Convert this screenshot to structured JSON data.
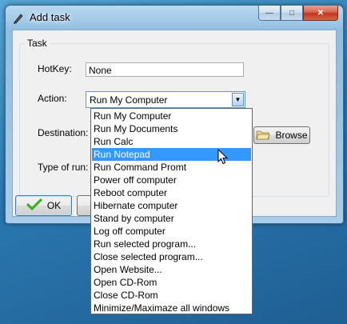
{
  "window": {
    "title": "Add task",
    "minimize_glyph": "—",
    "maximize_glyph": "□",
    "close_glyph": "✕"
  },
  "task_group": {
    "label": "Task",
    "hotkey_label": "HotKey:",
    "hotkey_value": "None",
    "action_label": "Action:",
    "action_value": "Run My Computer",
    "destination_label": "Destination:",
    "type_of_run_label": "Type of run:",
    "browse_label": "Browse"
  },
  "buttons": {
    "ok_label": "OK"
  },
  "action_options": [
    "Run My Computer",
    "Run My Documents",
    "Run Calc",
    "Run Notepad",
    "Run Command Promt",
    "Power off computer",
    "Reboot computer",
    "Hibernate computer",
    "Stand by computer",
    "Log off computer",
    "Run selected program...",
    "Close selected program...",
    "Open Website...",
    "Open CD-Rom",
    "Close CD-Rom",
    "Minimize/Maximaze all windows"
  ],
  "highlighted_option": "Run Notepad",
  "icons": {
    "app": "pen-icon",
    "ok": "checkmark-icon",
    "browse": "folder-icon",
    "dropdown": "chevron-down-icon"
  },
  "colors": {
    "selection": "#3399ff",
    "ok_check": "#3fae2a"
  }
}
